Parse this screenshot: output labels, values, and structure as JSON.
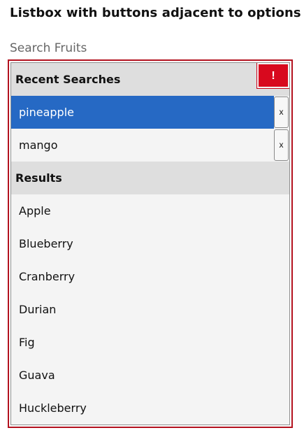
{
  "page": {
    "title": "Listbox with buttons adjacent to options",
    "search_label": "Search Fruits"
  },
  "listbox": {
    "alert_button_label": "!",
    "groups": [
      {
        "label": "Recent Searches",
        "items": [
          {
            "label": "pineapple",
            "remove_label": "x",
            "selected": true
          },
          {
            "label": "mango",
            "remove_label": "x",
            "selected": false
          }
        ]
      },
      {
        "label": "Results",
        "items": [
          {
            "label": "Apple"
          },
          {
            "label": "Blueberry"
          },
          {
            "label": "Cranberry"
          },
          {
            "label": "Durian"
          },
          {
            "label": "Fig"
          },
          {
            "label": "Guava"
          },
          {
            "label": "Huckleberry"
          }
        ]
      }
    ]
  },
  "colors": {
    "selected_background": "#2669c4",
    "outer_focus_border": "#b3121f",
    "alert_button": "#d8091e",
    "group_header_background": "#dedede",
    "list_background": "#f4f4f4"
  },
  "icons": {
    "alert": "exclamation-icon",
    "remove": "close-icon"
  }
}
